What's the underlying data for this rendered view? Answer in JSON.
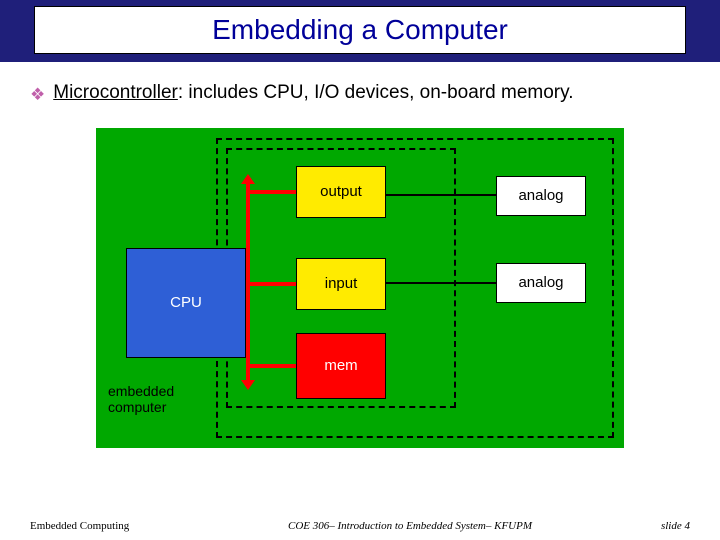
{
  "title": "Embedding a Computer",
  "bullet": {
    "term": "Microcontroller",
    "rest": ": includes CPU, I/O devices, on-board memory."
  },
  "diagram": {
    "cpu": "CPU",
    "output": "output",
    "input": "input",
    "mem": "mem",
    "analog1": "analog",
    "analog2": "analog",
    "embedded_label_line1": "embedded",
    "embedded_label_line2": "computer"
  },
  "footer": {
    "left": "Embedded Computing",
    "center": "COE 306– Introduction to Embedded System– KFUPM",
    "right": "slide 4"
  }
}
